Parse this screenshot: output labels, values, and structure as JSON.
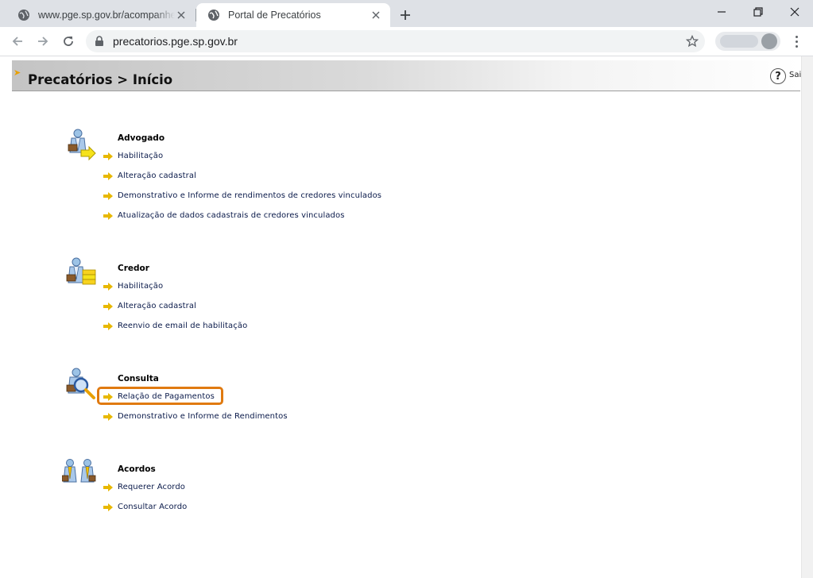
{
  "browser": {
    "tabs": [
      {
        "title": "www.pge.sp.gov.br/acompanhe/p",
        "active": false
      },
      {
        "title": "Portal de Precatórios",
        "active": true
      }
    ],
    "url": "precatorios.pge.sp.gov.br",
    "icons": {
      "back": "arrow-left-icon",
      "forward": "arrow-right-icon",
      "reload": "reload-icon",
      "lock": "lock-icon",
      "star": "star-icon",
      "menu": "kebab-menu-icon"
    }
  },
  "header": {
    "title": "Precatórios > Início",
    "help_label": "?",
    "exit_label": "Sair"
  },
  "sections": [
    {
      "title": "Advogado",
      "icon": "lawyer-icon",
      "links": [
        "Habilitação",
        "Alteração cadastral",
        "Demonstrativo e Informe de rendimentos de credores vinculados",
        "Atualização de dados cadastrais de credores vinculados"
      ]
    },
    {
      "title": "Credor",
      "icon": "creditor-icon",
      "links": [
        "Habilitação",
        "Alteração cadastral",
        "Reenvio de email de habilitação"
      ]
    },
    {
      "title": "Consulta",
      "icon": "search-person-icon",
      "links": [
        "Relação de Pagamentos",
        "Demonstrativo e Informe de Rendimentos"
      ]
    },
    {
      "title": "Acordos",
      "icon": "agreement-icon",
      "links": [
        "Requerer Acordo",
        "Consultar Acordo"
      ]
    }
  ],
  "colors": {
    "link": "#0a1a4a",
    "arrow": "#e8b800",
    "highlight": "#e07a10"
  }
}
